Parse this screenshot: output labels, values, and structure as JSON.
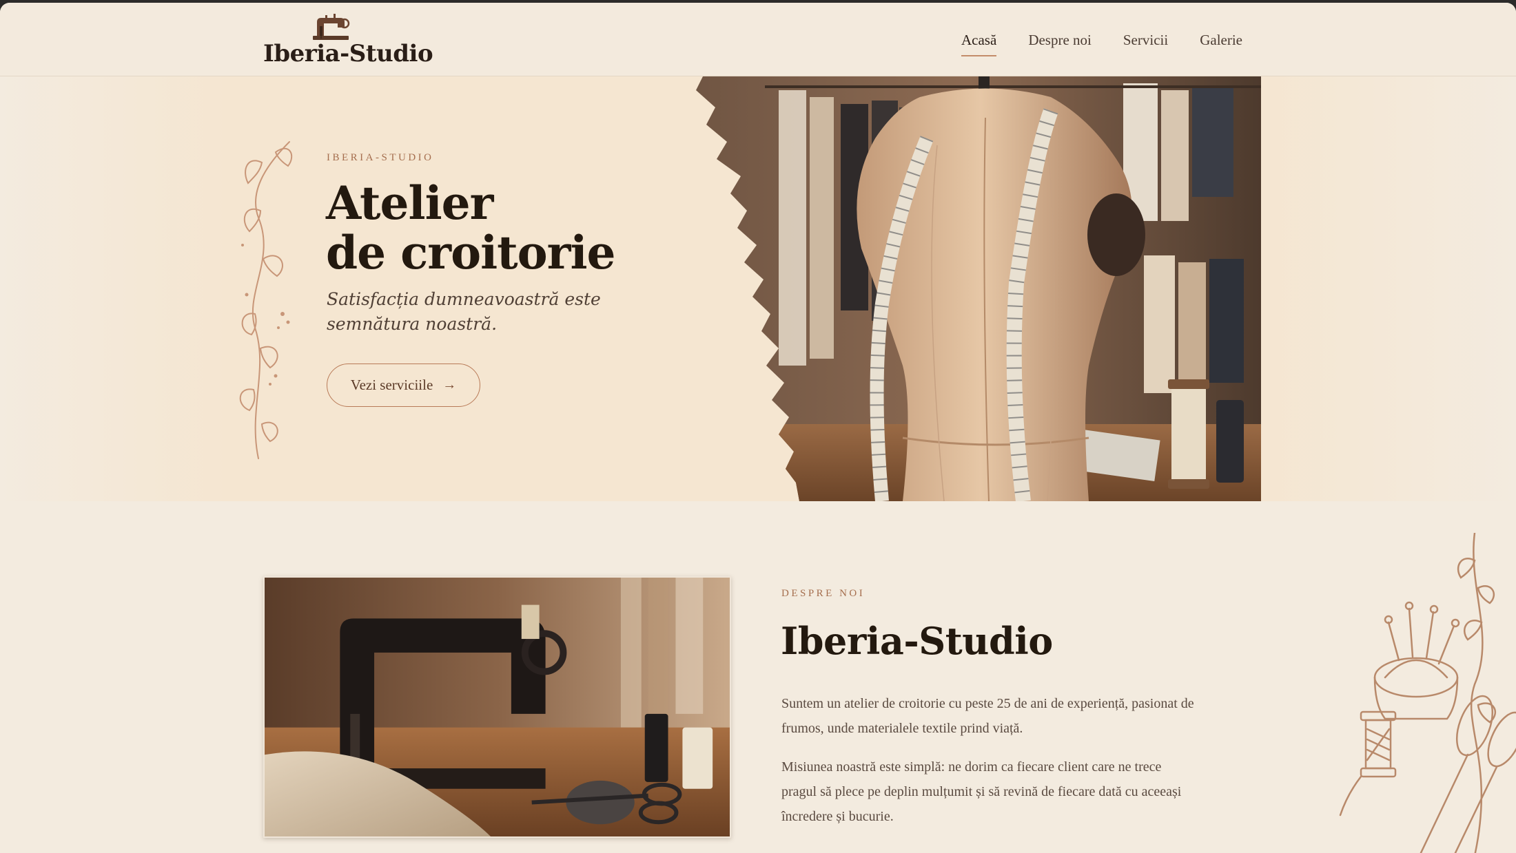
{
  "header": {
    "logo_text": "Iberia-Studio",
    "nav": [
      {
        "label": "Acasă",
        "active": true
      },
      {
        "label": "Despre noi",
        "active": false
      },
      {
        "label": "Servicii",
        "active": false
      },
      {
        "label": "Galerie",
        "active": false
      }
    ]
  },
  "hero": {
    "eyebrow": "IBERIA-STUDIO",
    "title_line1": "Atelier",
    "title_line2": "de croitorie",
    "tagline": "Satisfacția dumneavoastră este semnătura noastră.",
    "button_label": "Vezi serviciile",
    "button_icon": "arrow-right-icon"
  },
  "about": {
    "eyebrow": "DESPRE NOI",
    "title": "Iberia-Studio",
    "paragraph1": "Suntem un atelier de croitorie cu peste 25 de ani de experiență, pasionat de frumos, unde materialele textile prind viață.",
    "paragraph2": "Misiunea noastră este simplă: ne dorim ca fiecare client care ne trece pragul să plece pe deplin mulțumit și să revină de fiecare dată cu aceeași încredere și bucurie."
  },
  "colors": {
    "accent": "#b87a57",
    "text_dark": "#23190f",
    "background": "#f3ebdf",
    "hero_background": "#f5e6d1"
  }
}
